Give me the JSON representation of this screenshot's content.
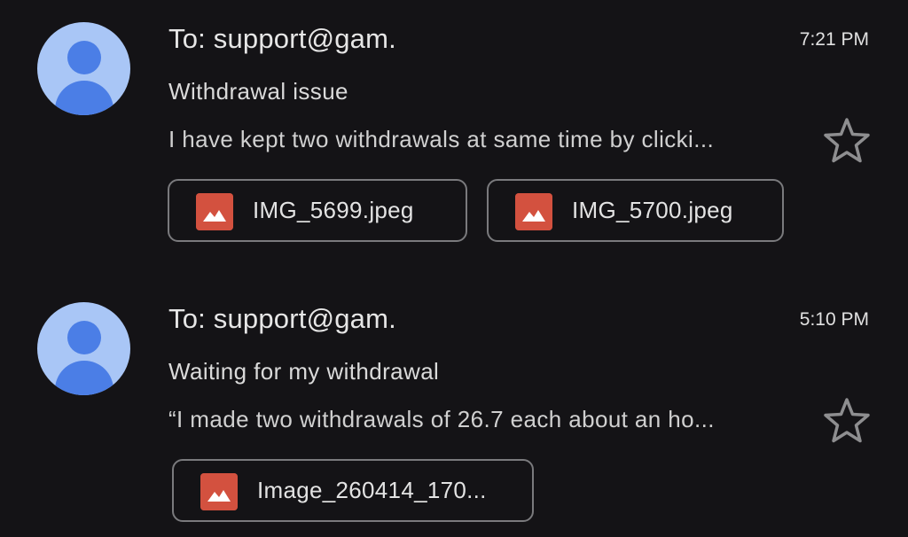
{
  "emails": [
    {
      "recipient": "To: support@gam.",
      "time": "7:21 PM",
      "subject": "Withdrawal issue",
      "snippet": "I have kept two withdrawals at same time by clicki...",
      "starred": false,
      "attachments": [
        {
          "name": "IMG_5699.jpeg",
          "icon": "image-icon"
        },
        {
          "name": "IMG_5700.jpeg",
          "icon": "image-icon"
        }
      ]
    },
    {
      "recipient": "To: support@gam.",
      "time": "5:10 PM",
      "subject": "Waiting for my withdrawal",
      "snippet": "“I made two withdrawals of 26.7 each about an ho...",
      "starred": false,
      "attachments": [
        {
          "name": "Image_260414_170...",
          "icon": "image-icon"
        }
      ]
    }
  ],
  "colors": {
    "background": "#141316",
    "avatar_bg": "#a9c6f6",
    "avatar_fg": "#4b7ee6",
    "attachment_icon": "#d3513f",
    "chip_border": "#7a7a7d"
  },
  "icons": {
    "avatar": "person-avatar-icon",
    "star": "star-outline-icon",
    "attachment": "image-icon"
  }
}
